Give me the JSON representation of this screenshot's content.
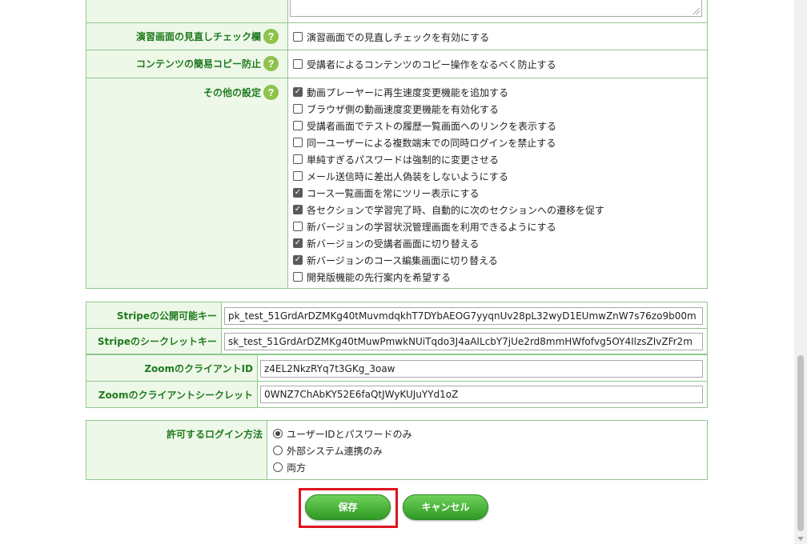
{
  "sections": {
    "review_check": {
      "label": "演習画面の見直しチェック欄",
      "option": "演習画面での見直しチェックを有効にする",
      "checked": false
    },
    "copy_protect": {
      "label": "コンテンツの簡易コピー防止",
      "option": "受講者によるコンテンツのコピー操作をなるべく防止する",
      "checked": false
    },
    "other_settings": {
      "label": "その他の設定",
      "options": [
        {
          "text": "動画プレーヤーに再生速度変更機能を追加する",
          "checked": true
        },
        {
          "text": "ブラウザ側の動画速度変更機能を有効化する",
          "checked": false
        },
        {
          "text": "受講者画面でテストの履歴一覧画面へのリンクを表示する",
          "checked": false
        },
        {
          "text": "同一ユーザーによる複数端末での同時ログインを禁止する",
          "checked": false
        },
        {
          "text": "単純すぎるパスワードは強制的に変更させる",
          "checked": false
        },
        {
          "text": "メール送信時に差出人偽装をしないようにする",
          "checked": false
        },
        {
          "text": "コース一覧画面を常にツリー表示にする",
          "checked": true
        },
        {
          "text": "各セクションで学習完了時、自動的に次のセクションへの遷移を促す",
          "checked": true
        },
        {
          "text": "新バージョンの学習状況管理画面を利用できるようにする",
          "checked": false
        },
        {
          "text": "新バージョンの受講者画面に切り替える",
          "checked": true
        },
        {
          "text": "新バージョンのコース編集画面に切り替える",
          "checked": true
        },
        {
          "text": "開発版機能の先行案内を希望する",
          "checked": false
        }
      ]
    },
    "keys": {
      "stripe_public_label": "Stripeの公開可能キー",
      "stripe_public_value": "pk_test_51GrdArDZMKg40tMuvmdqkhT7DYbAEOG7yyqnUv28pL32wyD1EUmwZnW7s76zo9b00m",
      "stripe_secret_label": "Stripeのシークレットキー",
      "stripe_secret_value": "sk_test_51GrdArDZMKg40tMuwPmwkNUiTqdo3J4aAILcbY7jUe2rd8mmHWfofvg5OY4IlzsZIvZFr2m",
      "zoom_client_id_label": "ZoomのクライアントID",
      "zoom_client_id_value": "z4EL2NkzRYq7t3GKg_3oaw",
      "zoom_client_secret_label": "Zoomのクライアントシークレット",
      "zoom_client_secret_value": "0WNZ7ChAbKY52E6faQtJWyKUJuYYd1oZ"
    },
    "login_method": {
      "label": "許可するログイン方法",
      "options": [
        {
          "text": "ユーザーIDとパスワードのみ",
          "selected": true
        },
        {
          "text": "外部システム連携のみ",
          "selected": false
        },
        {
          "text": "両方",
          "selected": false
        }
      ]
    }
  },
  "buttons": {
    "save": "保存",
    "cancel": "キャンセル"
  },
  "icons": {
    "help": "question-circle-icon",
    "help_glyph": "?"
  },
  "colors": {
    "label_bg": "#eef8e9",
    "label_text": "#1f7a1f",
    "border": "#8fc78f",
    "button_green": "#3aa82e",
    "highlight": "#e0141e"
  }
}
